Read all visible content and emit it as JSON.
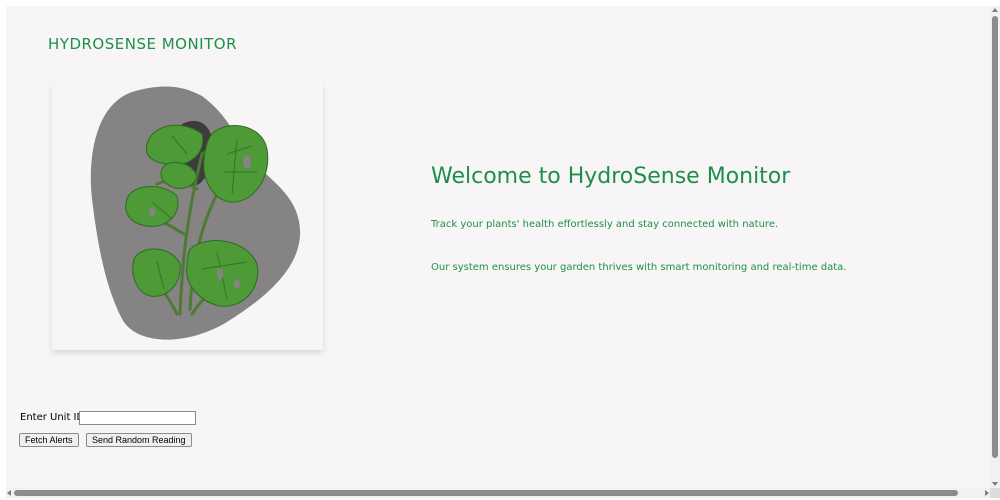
{
  "header": {
    "brand": "HYDROSENSE MONITOR"
  },
  "hero": {
    "title": "Welcome to HydroSense Monitor",
    "line1": "Track your plants' health effortlessly and stay connected with nature.",
    "line2": "Our system ensures your garden thrives with smart monitoring and real-time data."
  },
  "controls": {
    "unit_label": "Enter Unit ID:",
    "unit_value": "",
    "fetch_label": "Fetch Alerts",
    "send_label": "Send Random Reading"
  },
  "colors": {
    "accent": "#1e8f4a",
    "background": "#f7f5f5",
    "blob": "#858383",
    "leaf": "#3f8a2e"
  },
  "icons": {
    "hero_image": "monstera-plant-illustration"
  }
}
